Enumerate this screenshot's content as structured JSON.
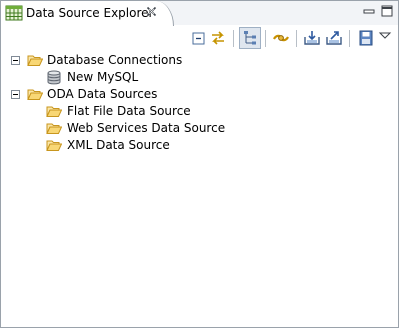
{
  "view": {
    "title": "Data Source Explorer",
    "tab_icon": "data-source-explorer-icon",
    "close_icon": "close-icon",
    "minimize_icon": "minimize-icon",
    "maximize_icon": "maximize-icon"
  },
  "toolbar": {
    "buttons": [
      {
        "icon": "collapse-all-icon",
        "pressed": false
      },
      {
        "icon": "link-with-editor-icon",
        "pressed": false
      },
      {
        "icon": "show-hierarchy-icon",
        "pressed": true
      },
      {
        "icon": "connect-icon",
        "pressed": false
      },
      {
        "icon": "import-icon",
        "pressed": false
      },
      {
        "icon": "export-icon",
        "pressed": false
      },
      {
        "icon": "save-icon",
        "pressed": false
      },
      {
        "icon": "view-menu-icon",
        "pressed": false
      }
    ]
  },
  "tree": {
    "database_connections": {
      "label": "Database Connections",
      "expanded": true,
      "children": [
        {
          "label": "New MySQL",
          "icon": "database-icon"
        }
      ]
    },
    "oda_data_sources": {
      "label": "ODA Data Sources",
      "expanded": true,
      "children": [
        {
          "label": "Flat File Data Source",
          "icon": "folder-icon"
        },
        {
          "label": "Web Services Data Source",
          "icon": "folder-icon"
        },
        {
          "label": "XML Data Source",
          "icon": "folder-icon"
        }
      ]
    }
  },
  "colors": {
    "border": "#9aa2ab",
    "tabbar_bg": "#f2f4f7",
    "folder_fill": "#f8d775",
    "folder_stroke": "#c8961e"
  }
}
